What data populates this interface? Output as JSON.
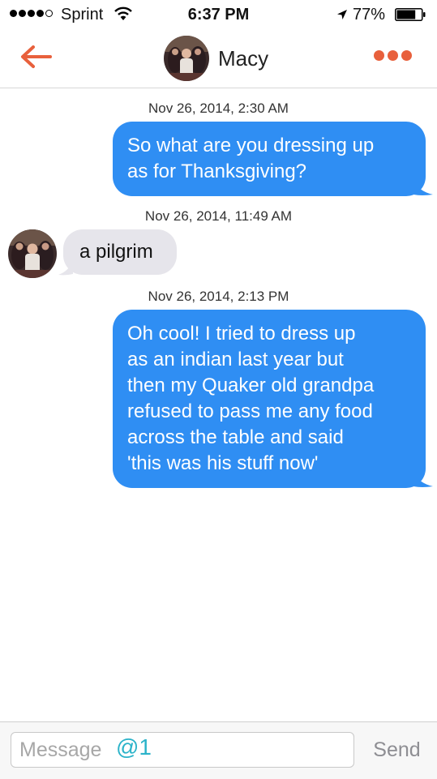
{
  "status_bar": {
    "carrier": "Sprint",
    "time": "6:37 PM",
    "battery_percent": "77%",
    "battery_level": 0.77,
    "signal_bars_filled": 4,
    "icons": [
      "signal-dots-icon",
      "wifi-icon",
      "location-arrow-icon",
      "battery-icon"
    ]
  },
  "header": {
    "contact_name": "Macy",
    "icons": [
      "back-arrow-icon",
      "more-dots-icon"
    ],
    "accent_color": "#e8603c"
  },
  "messages": [
    {
      "timestamp": "Nov 26, 2014, 2:30 AM",
      "direction": "outgoing",
      "lines": [
        "So what are you dressing up",
        "as for Thanksgiving?"
      ]
    },
    {
      "timestamp": "Nov 26, 2014, 11:49 AM",
      "direction": "incoming",
      "lines": [
        "a pilgrim"
      ]
    },
    {
      "timestamp": "Nov 26, 2014, 2:13 PM",
      "direction": "outgoing",
      "lines": [
        "Oh cool! I tried to dress up",
        "as an indian last year but",
        "then my Quaker old grandpa",
        "refused to pass me any food",
        "across the table and said",
        "'this was his stuff now'"
      ]
    }
  ],
  "composer": {
    "placeholder": "Message",
    "send_label": "Send",
    "watermark": "@1"
  },
  "colors": {
    "outgoing_bubble": "#2f8ef3",
    "incoming_bubble": "#e6e5eb"
  }
}
